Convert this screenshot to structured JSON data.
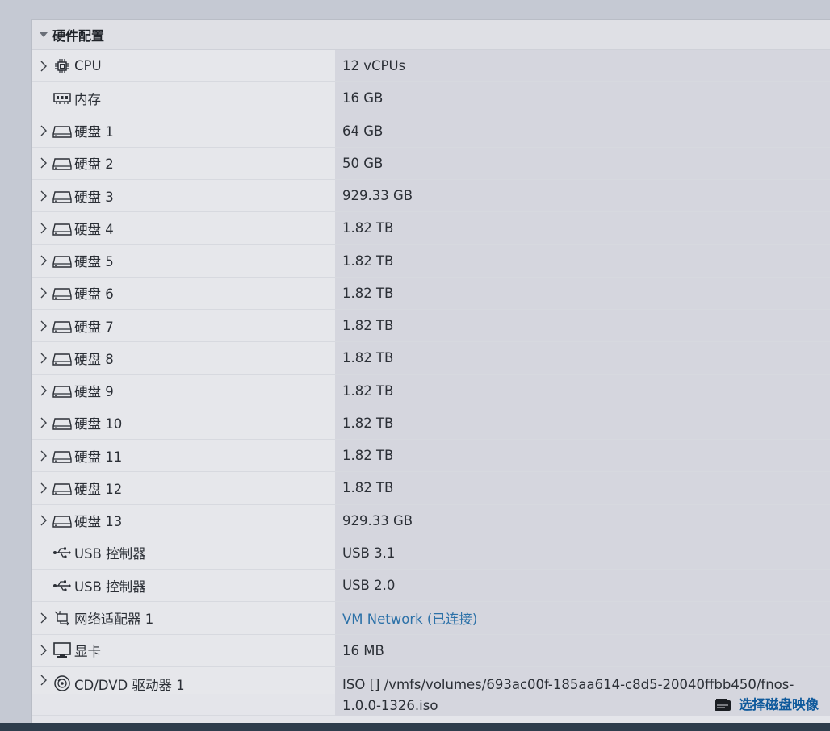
{
  "section": {
    "title": "硬件配置"
  },
  "rows": [
    {
      "label": "CPU",
      "value": "12 vCPUs",
      "icon": "cpu-icon",
      "expandable": true
    },
    {
      "label": "内存",
      "value": "16 GB",
      "icon": "memory-icon",
      "expandable": false
    },
    {
      "label": "硬盘 1",
      "value": "64 GB",
      "icon": "hard-disk-icon",
      "expandable": true
    },
    {
      "label": "硬盘 2",
      "value": "50 GB",
      "icon": "hard-disk-icon",
      "expandable": true
    },
    {
      "label": "硬盘 3",
      "value": "929.33 GB",
      "icon": "hard-disk-icon",
      "expandable": true
    },
    {
      "label": "硬盘 4",
      "value": "1.82 TB",
      "icon": "hard-disk-icon",
      "expandable": true
    },
    {
      "label": "硬盘 5",
      "value": "1.82 TB",
      "icon": "hard-disk-icon",
      "expandable": true
    },
    {
      "label": "硬盘 6",
      "value": "1.82 TB",
      "icon": "hard-disk-icon",
      "expandable": true
    },
    {
      "label": "硬盘 7",
      "value": "1.82 TB",
      "icon": "hard-disk-icon",
      "expandable": true
    },
    {
      "label": "硬盘 8",
      "value": "1.82 TB",
      "icon": "hard-disk-icon",
      "expandable": true
    },
    {
      "label": "硬盘 9",
      "value": "1.82 TB",
      "icon": "hard-disk-icon",
      "expandable": true
    },
    {
      "label": "硬盘 10",
      "value": "1.82 TB",
      "icon": "hard-disk-icon",
      "expandable": true
    },
    {
      "label": "硬盘 11",
      "value": "1.82 TB",
      "icon": "hard-disk-icon",
      "expandable": true
    },
    {
      "label": "硬盘 12",
      "value": "1.82 TB",
      "icon": "hard-disk-icon",
      "expandable": true
    },
    {
      "label": "硬盘 13",
      "value": "929.33 GB",
      "icon": "hard-disk-icon",
      "expandable": true
    },
    {
      "label": "USB 控制器",
      "value": "USB 3.1",
      "icon": "usb-icon",
      "expandable": false
    },
    {
      "label": "USB 控制器",
      "value": "USB 2.0",
      "icon": "usb-icon",
      "expandable": false
    },
    {
      "label": "网络适配器 1",
      "value": "VM Network (已连接)",
      "icon": "network-adapter-icon",
      "expandable": true,
      "link": true
    },
    {
      "label": "显卡",
      "value": "16 MB",
      "icon": "monitor-icon",
      "expandable": true
    }
  ],
  "cdrom": {
    "label": "CD/DVD 驱动器 1",
    "value": "ISO [] /vmfs/volumes/693ac00f-185aa614-c8d5-20040ffbb450/fnos-1.0.0-1326.iso",
    "icon": "cd-dvd-icon",
    "action_label": "选择磁盘映像"
  }
}
